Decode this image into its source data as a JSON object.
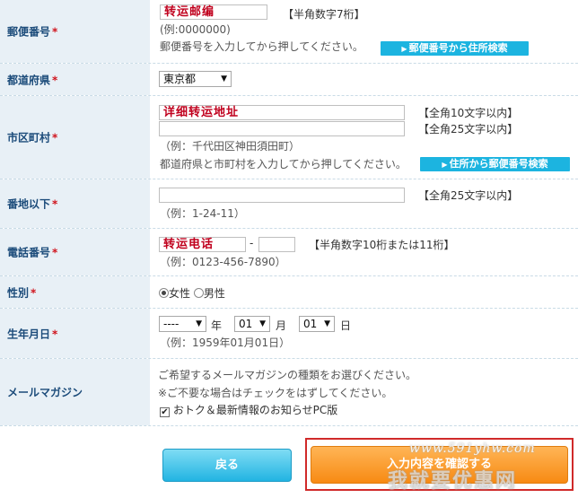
{
  "postal": {
    "label": "郵便番号",
    "required_mark": "*",
    "value": "转运邮编",
    "note": "【半角数字7桁】",
    "example": "(例:0000000)",
    "hint": "郵便番号を入力してから押してください。",
    "lookup_button": "郵便番号から住所検索"
  },
  "prefecture": {
    "label": "都道府県",
    "required_mark": "*",
    "selected": "東京都"
  },
  "city": {
    "label": "市区町村",
    "required_mark": "*",
    "value1": "详细转运地址",
    "value2": "",
    "note1": "【全角10文字以内】",
    "note2": "【全角25文字以内】",
    "example": "（例：千代田区神田須田町）",
    "hint": "都道府県と市町村を入力してから押してください。",
    "lookup_button": "住所から郵便番号検索"
  },
  "address": {
    "label": "番地以下",
    "required_mark": "*",
    "value": "",
    "note": "【全角25文字以内】",
    "example": "（例：1-24-11）"
  },
  "phone": {
    "label": "電話番号",
    "required_mark": "*",
    "value1": "转运电话",
    "separator": "-",
    "value2": "",
    "note": "【半角数字10桁または11桁】",
    "example": "（例：0123-456-7890）"
  },
  "gender": {
    "label": "性別",
    "required_mark": "*",
    "female": "女性",
    "male": "男性",
    "selected": "female"
  },
  "birthday": {
    "label": "生年月日",
    "required_mark": "*",
    "year_value": "----",
    "year_label": "年",
    "month_value": "01",
    "month_label": "月",
    "day_value": "01",
    "day_label": "日",
    "example": "（例：1959年01月01日）"
  },
  "magazine": {
    "label": "メールマガジン",
    "line1": "ご希望するメールマガジンの種類をお選びください。",
    "line2": "※ご不要な場合はチェックをはずしてください。",
    "checkbox_label": "おトク＆最新情報のお知らせPC版",
    "checked": true
  },
  "buttons": {
    "back": "戻る",
    "next": "入力内容を確認する"
  },
  "watermark": {
    "url": "www.591yhw.com",
    "text": "我就要优惠网"
  },
  "colors": {
    "label_bg": "#e8f0f6",
    "label_text": "#1b4b7a",
    "required": "#d0121b",
    "blue_button": "#1cb4e0",
    "orange_button": "#f78a13",
    "highlight_frame": "#d02a2a"
  }
}
